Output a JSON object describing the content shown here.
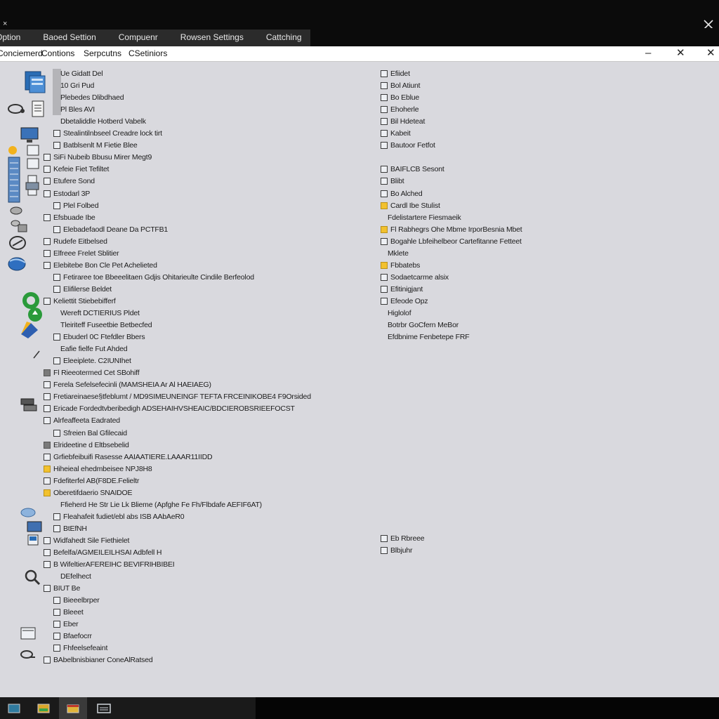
{
  "title_glyph": "×",
  "tabs": [
    {
      "label": "Option"
    },
    {
      "label": "Baoed Settion"
    },
    {
      "label": "Compuenr"
    },
    {
      "label": "Rowsen Settings"
    },
    {
      "label": "Cattching"
    }
  ],
  "menu": [
    {
      "label": "Conciemerd"
    },
    {
      "label": "Contions"
    },
    {
      "label": "Serpcutns"
    },
    {
      "label": "CSetiniors"
    }
  ],
  "window_controls": {
    "minimize": "–",
    "maximize": "✕",
    "close": "✕"
  },
  "left_tree": [
    {
      "label": "Ue Gidatt Del",
      "icon": "none",
      "indent": 0
    },
    {
      "label": "10 Gri Pud",
      "icon": "none",
      "indent": 0
    },
    {
      "label": "Plebedes Dlibdhaed",
      "icon": "none",
      "indent": 0
    },
    {
      "label": "Pl Bles AVI",
      "icon": "none",
      "indent": 0
    },
    {
      "label": "Dbetaliddle Hotberd Vabelk",
      "icon": "none",
      "indent": 0
    },
    {
      "label": "Stealintilnbseel Creadre lock tirt",
      "icon": "box",
      "indent": 0
    },
    {
      "label": "Batblsenlt M Fietie Blee",
      "icon": "box",
      "indent": 0
    },
    {
      "label": "SiFi Nubeib Bbusu Mirer Megt9",
      "icon": "box",
      "indent": -1
    },
    {
      "label": "Kefeie Fiet Tefiltet",
      "icon": "box",
      "indent": -1
    },
    {
      "label": "Etufere Sond",
      "icon": "box",
      "indent": -1
    },
    {
      "label": "Estodarl 3P",
      "icon": "box",
      "indent": -1
    },
    {
      "label": "Plel Folbed",
      "icon": "box",
      "indent": 0
    },
    {
      "label": "Efsbuade Ibe",
      "icon": "box",
      "indent": -1
    },
    {
      "label": "Elebadefaodl Deane Da PCTFB1",
      "icon": "box",
      "indent": 0
    },
    {
      "label": "Rudefe Eitbelsed",
      "icon": "box",
      "indent": -1
    },
    {
      "label": "Elfreee Frelet Sblitier",
      "icon": "box",
      "indent": -1
    },
    {
      "label": "Elebitebe Bon Cle Pet Achelieted",
      "icon": "box",
      "indent": -1
    },
    {
      "label": "Fetiraree toe Bbeeelitaen Gdjis Ohitarieulte Cindile Berfeolod",
      "icon": "box",
      "indent": 0
    },
    {
      "label": "Elifilerse Beldet",
      "icon": "box",
      "indent": 0
    },
    {
      "label": "Keliettit Stiebebifferf",
      "icon": "box",
      "indent": -1
    },
    {
      "label": "Wereft DCTIERIUS Pldet",
      "icon": "none",
      "indent": 0
    },
    {
      "label": "Tleiriteff Fuseetbie Betbecfed",
      "icon": "none",
      "indent": 0
    },
    {
      "label": "Ebuderl 0C Ftefdler Bbers",
      "icon": "box",
      "indent": 0
    },
    {
      "label": "Eafie fielfe Fut Ahded",
      "icon": "none",
      "indent": 0
    },
    {
      "label": "Eleeiplete. C2IUNIhet",
      "icon": "box",
      "indent": 0
    },
    {
      "label": "Fl Rieeotermed Cet SBohiff",
      "icon": "gray",
      "indent": -1
    },
    {
      "label": "Ferela Sefelsefecinli (MAMSHEIA Ar Al HAEIAEG)",
      "icon": "box",
      "indent": -1
    },
    {
      "label": "Fretiareinaese§tfeblumt / MD9SIMEUNEINGF TEFTA FRCEINIKOBE4 F9Orsided",
      "icon": "box",
      "indent": -1
    },
    {
      "label": "Ericade Fordedtvberibedigh ADSEHAIHVSHEAIC/BDCIEROBSRIEEFOCST",
      "icon": "box",
      "indent": -1
    },
    {
      "label": "Alrfeaffeeta Eadrated",
      "icon": "box",
      "indent": -1
    },
    {
      "label": "Sfreien Bal Gfilecaid",
      "icon": "box",
      "indent": 0
    },
    {
      "label": "Elrideetine d Eltbsebelid",
      "icon": "gray",
      "indent": -1
    },
    {
      "label": "Grfiebfeibuifi Rasesse AAIAATIERE.LAAAR11IIDD",
      "icon": "box",
      "indent": -1
    },
    {
      "label": "Hiheieal ehedmbeisee NPJ8H8",
      "icon": "folder",
      "indent": -1
    },
    {
      "label": "Fdefiterfel AB(F8DE.Felieltr",
      "icon": "box",
      "indent": -1
    },
    {
      "label": "Oberetifdaerio SNAIDOE",
      "icon": "folder",
      "indent": -1
    },
    {
      "label": "Ffieherd He Str Lie Lk Blieme (Apfghe Fe Fh/Flbdafe AEFIF6AT)",
      "icon": "none",
      "indent": 0
    },
    {
      "label": "Fleahafeit fudiet/ebl abs ISB AAbAeR0",
      "icon": "box",
      "indent": 0
    },
    {
      "label": "BtEfNH",
      "icon": "box",
      "indent": 0
    },
    {
      "label": "Widfahedt Sile Fiethielet",
      "icon": "box",
      "indent": -1
    },
    {
      "label": "Befelfa/AGMEILEILHSAI Adbfell H",
      "icon": "box",
      "indent": -1
    },
    {
      "label": "B WifeltierAFEREIHC BEVIFRIHBIBEI",
      "icon": "box",
      "indent": -1
    },
    {
      "label": "DEfelhect",
      "icon": "none",
      "indent": 0
    },
    {
      "label": "BIUT Be",
      "icon": "box",
      "indent": -1
    },
    {
      "label": "Bieeelbrper",
      "icon": "box",
      "indent": 0
    },
    {
      "label": "Bleeet",
      "icon": "box",
      "indent": 0
    },
    {
      "label": "Eber",
      "icon": "box",
      "indent": 0
    },
    {
      "label": "Bfaefocrr",
      "icon": "box",
      "indent": 0
    },
    {
      "label": "Fhfeelsefeaint",
      "icon": "box",
      "indent": 0
    },
    {
      "label": "BAbelbnisbianer ConeAlRatsed",
      "icon": "box",
      "indent": -1
    }
  ],
  "right_tree": [
    {
      "label": "Efiidet",
      "icon": "box"
    },
    {
      "label": "Bol Atiunt",
      "icon": "box"
    },
    {
      "label": "Bo Eblue",
      "icon": "box"
    },
    {
      "label": "Ehoherle",
      "icon": "box"
    },
    {
      "label": "Bil Hdeteat",
      "icon": "box"
    },
    {
      "label": "Kabeit",
      "icon": "box"
    },
    {
      "label": "Bautoor Fetfot",
      "icon": "box"
    },
    {
      "label": "",
      "icon": "none"
    },
    {
      "label": "BAIFLCB Sesont",
      "icon": "box"
    },
    {
      "label": "Blibt",
      "icon": "box"
    },
    {
      "label": "Bo Alched",
      "icon": "box"
    },
    {
      "label": "Cardl Ibe Stulist",
      "icon": "folder"
    },
    {
      "label": "Fdelistartere Fiesmaeik",
      "icon": "none"
    },
    {
      "label": "Fl Rabhegrs Ohe Mbme IrporBesnia Mbet",
      "icon": "folder"
    },
    {
      "label": "Bogahle Lbfeihelbeor Cartefitanne Fetteet",
      "icon": "box"
    },
    {
      "label": "Mklete",
      "icon": "none"
    },
    {
      "label": "Fbbatebs",
      "icon": "folder"
    },
    {
      "label": "Sodaetcarme alsix",
      "icon": "box"
    },
    {
      "label": "Efitinigjant",
      "icon": "box"
    },
    {
      "label": "Efeode Opz",
      "icon": "box"
    },
    {
      "label": "Higlolof",
      "icon": "none"
    },
    {
      "label": "Botrbr GoCfern MeBor",
      "icon": "none"
    },
    {
      "label": "Efdbnime Fenbetepe FRF",
      "icon": "none"
    }
  ],
  "right_tree_lower": [
    {
      "label": "Eb Rbreee",
      "icon": "box"
    },
    {
      "label": "Blbjuhr",
      "icon": "box"
    }
  ],
  "taskbar": [
    {
      "name": "taskbar-app-explorer",
      "color": "#2f7a9e"
    },
    {
      "name": "taskbar-app-files",
      "color": "#d9a52a"
    },
    {
      "name": "taskbar-app-folder",
      "color": "#e0b43a"
    },
    {
      "name": "taskbar-app-computer",
      "color": "#9aa2ad"
    }
  ]
}
